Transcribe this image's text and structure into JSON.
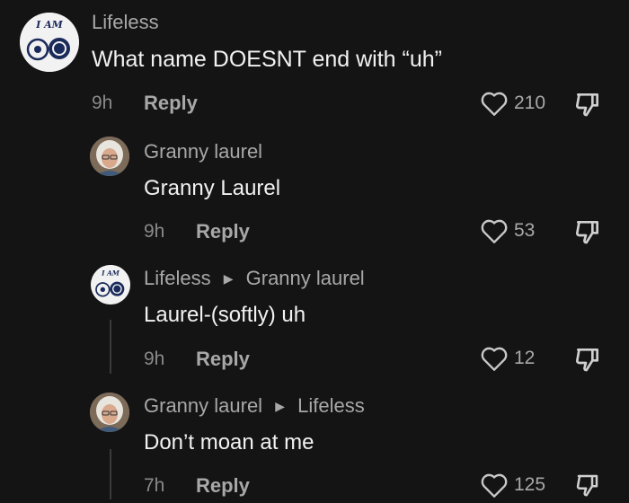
{
  "comments": [
    {
      "username": "Lifeless",
      "reply_to": "",
      "text": "What name DOESNT end with “uh”",
      "time": "9h",
      "reply_label": "Reply",
      "likes": "210",
      "avatar": "iam-logo-avatar"
    },
    {
      "username": "Granny laurel",
      "reply_to": "",
      "text": "Granny Laurel",
      "time": "9h",
      "reply_label": "Reply",
      "likes": "53",
      "avatar": "granny-photo-avatar"
    },
    {
      "username": "Lifeless",
      "reply_to": "Granny laurel",
      "text": "Laurel-(softly) uh",
      "time": "9h",
      "reply_label": "Reply",
      "likes": "12",
      "avatar": "iam-logo-avatar"
    },
    {
      "username": "Granny laurel",
      "reply_to": "Lifeless",
      "text": "Don’t moan at me",
      "time": "7h",
      "reply_label": "Reply",
      "likes": "125",
      "avatar": "granny-photo-avatar"
    }
  ],
  "logo_text": "I AM",
  "icons": {
    "like": "heart-outline-icon",
    "dislike": "thumbs-down-icon"
  },
  "colors": {
    "background": "#141414",
    "text": "#f2f2f2",
    "muted": "#a8a8a8"
  }
}
